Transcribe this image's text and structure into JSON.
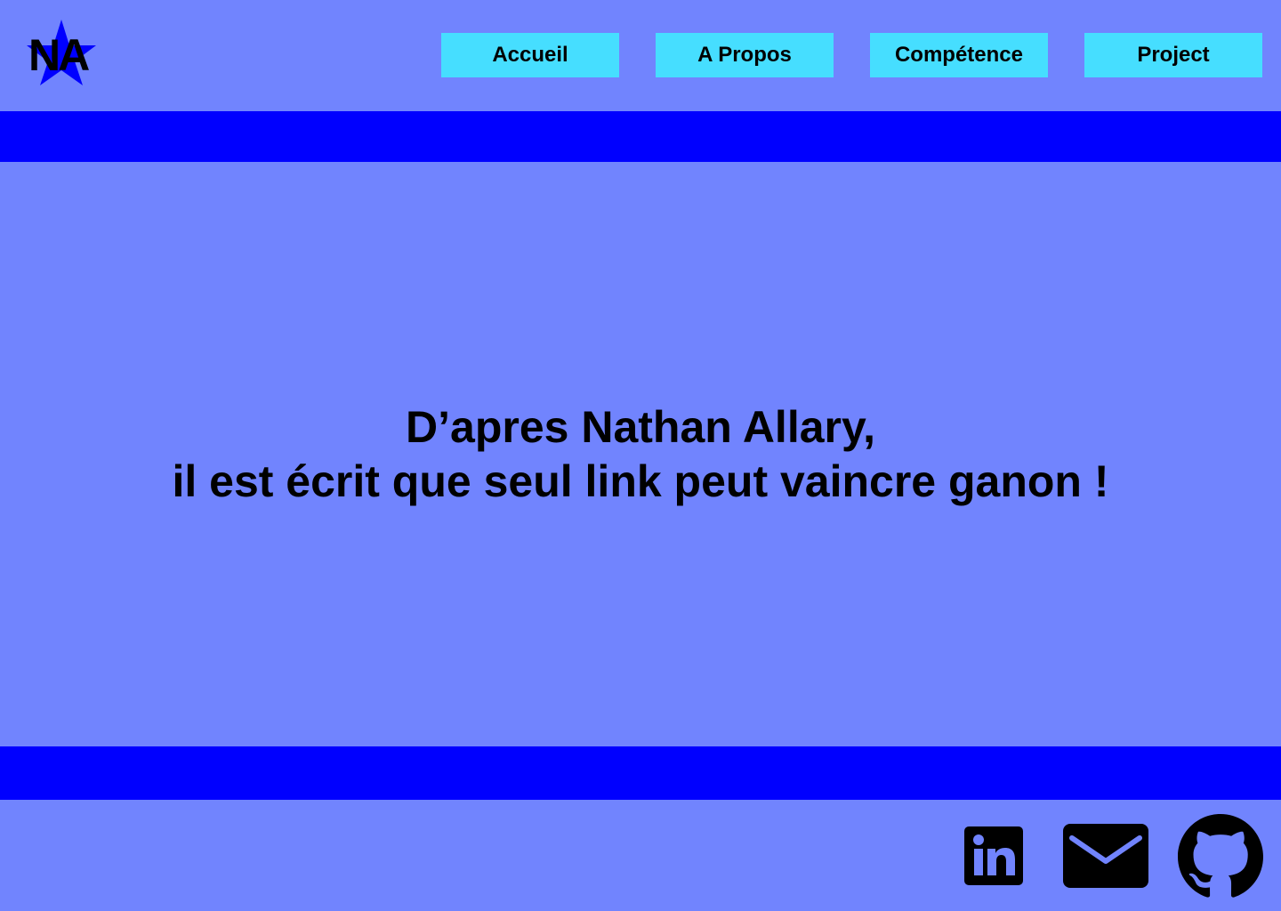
{
  "logo": {
    "text": "NA",
    "icon": "star-icon",
    "star_color": "#0000FF"
  },
  "nav": {
    "items": [
      {
        "label": "Accueil"
      },
      {
        "label": "A Propos"
      },
      {
        "label": "Compétence"
      },
      {
        "label": "Project"
      }
    ],
    "button_color": "#46DEFF"
  },
  "main": {
    "quote_line1": "D’apres Nathan Allary,",
    "quote_line2": "il est écrit que seul link peut vaincre ganon !"
  },
  "footer": {
    "social": [
      {
        "icon": "linkedin-icon"
      },
      {
        "icon": "mail-icon"
      },
      {
        "icon": "github-icon"
      }
    ]
  },
  "colors": {
    "background": "#7184FE",
    "band": "#0000FF",
    "text": "#000000"
  }
}
